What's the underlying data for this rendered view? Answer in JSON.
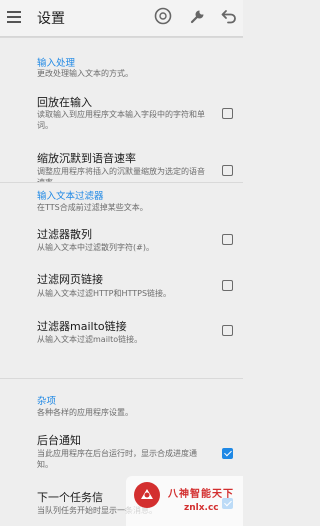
{
  "toolbar": {
    "title": "设置",
    "menu_icon": "hamburger-menu-icon",
    "icons": [
      "help-icon",
      "wrench-icon",
      "undo-icon"
    ]
  },
  "sections": [
    {
      "title": "输入处理",
      "summary": "更改处理输入文本的方式。",
      "items": [
        {
          "title": "回放在输入",
          "summary": "读取输入到应用程序文本输入字段中的字符和单词。",
          "checked": false
        },
        {
          "title": "缩放沉默到语音速率",
          "summary": "调整应用程序将插入的沉默量缩放为选定的语音速率。",
          "checked": false
        }
      ]
    },
    {
      "title": "输入文本过滤器",
      "summary": "在TTS合成前过滤掉某些文本。",
      "items": [
        {
          "title": "过滤器散列",
          "summary": "从输入文本中过滤散列字符(#)。",
          "checked": false
        },
        {
          "title": "过滤网页链接",
          "summary": "从输入文本过滤HTTP和HTTPS链接。",
          "checked": false
        },
        {
          "title": "过滤器mailto链接",
          "summary": "从输入文本过滤mailto链接。",
          "checked": false
        }
      ]
    },
    {
      "title": "杂项",
      "summary": "各种各样的应用程序设置。",
      "items": [
        {
          "title": "后台通知",
          "summary": "当此应用程序在后台运行时，显示合成进度通知。",
          "checked": true
        },
        {
          "title": "下一个任务信",
          "summary": "当队列任务开始时显示一条消息。",
          "checked": true
        }
      ]
    }
  ],
  "watermark": {
    "name": "八神智能天下",
    "url": "znlx.cc"
  },
  "colors": {
    "accent": "#1e88e5",
    "background": "#eeeeee",
    "watermark": "#d32f2f"
  }
}
